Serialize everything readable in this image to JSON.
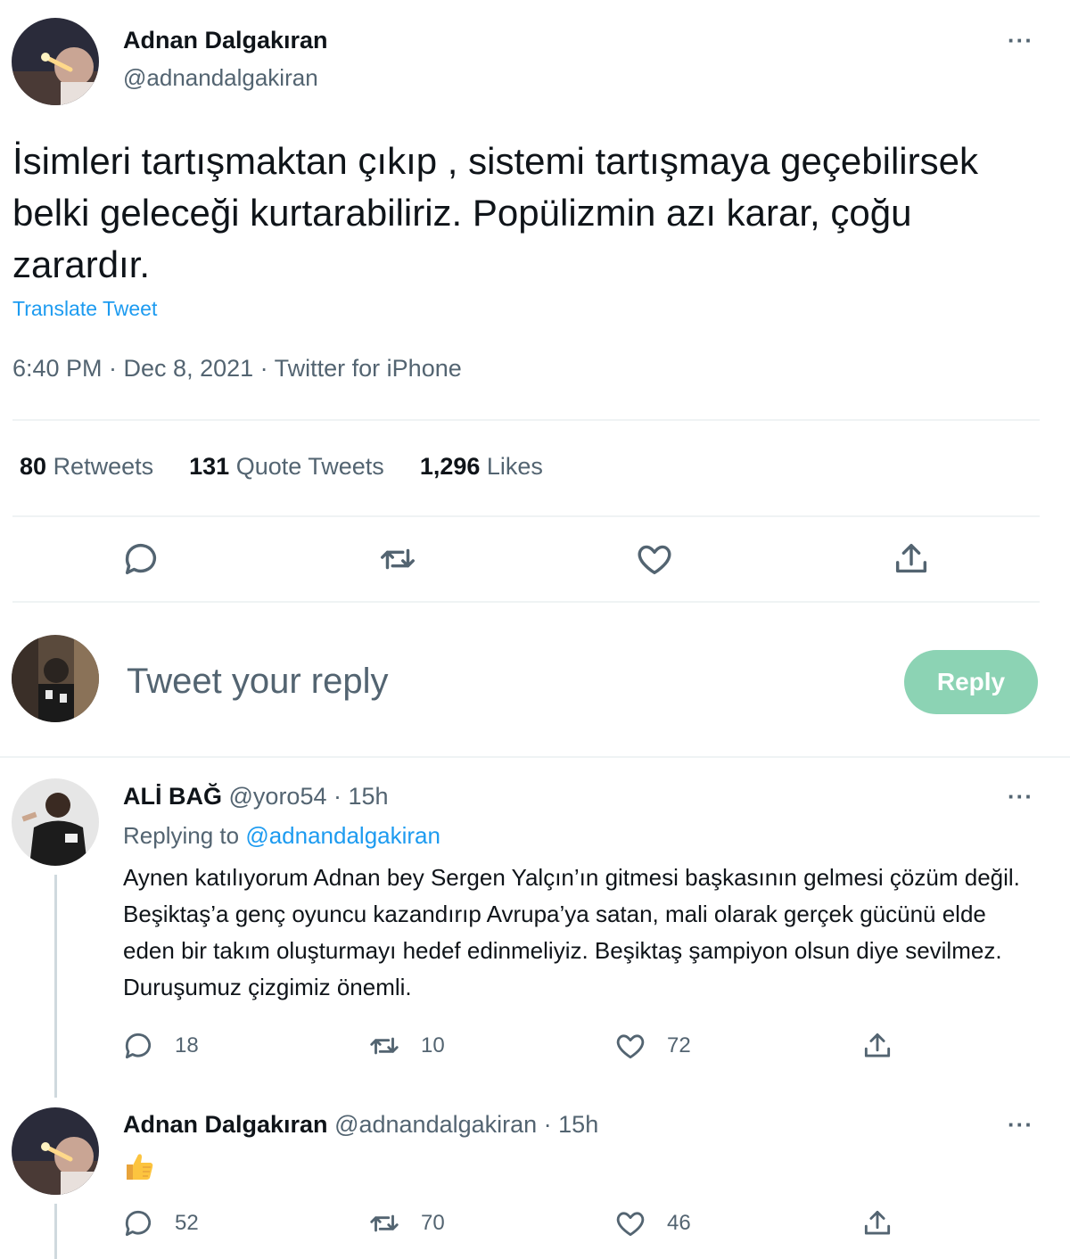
{
  "main_tweet": {
    "author_name": "Adnan Dalgakıran",
    "author_handle": "@adnandalgakiran",
    "more_label": "···",
    "text": "İsimleri tartışmaktan çıkıp , sistemi tartışmaya geçebilirsek belki geleceği kurtarabiliriz. Popülizmin azı karar, çoğu zarardır.",
    "translate_label": "Translate Tweet",
    "meta": "6:40 PM · Dec 8, 2021 · Twitter for iPhone",
    "stats": [
      {
        "count": "80",
        "label": "Retweets"
      },
      {
        "count": "131",
        "label": "Quote Tweets"
      },
      {
        "count": "1,296",
        "label": "Likes"
      }
    ]
  },
  "composer": {
    "placeholder": "Tweet your reply",
    "reply_button": "Reply"
  },
  "replies": [
    {
      "author_name": "ALİ BAĞ",
      "author_handle": "@yoro54",
      "time": "· 15h",
      "replying_prefix": "Replying to",
      "replying_to": "@adnandalgakiran",
      "text": "Aynen katılıyorum Adnan bey Sergen Yalçın’ın gitmesi başkasının gelmesi çözüm değil. Beşiktaş’a genç oyuncu kazandırıp Avrupa’ya satan, mali olarak gerçek gücünü elde eden bir takım oluşturmayı hedef edinmeliyiz. Beşiktaş şampiyon olsun diye sevilmez. Duruşumuz çizgimiz önemli.",
      "reply_count": "18",
      "retweet_count": "10",
      "like_count": "72",
      "more_label": "···"
    },
    {
      "author_name": "Adnan Dalgakıran",
      "author_handle": "@adnandalgakiran",
      "time": "· 15h",
      "emoji": "thumbs-up-icon",
      "reply_count": "52",
      "retweet_count": "70",
      "like_count": "46",
      "more_label": "···"
    }
  ],
  "colors": {
    "accent": "#1d9bf0",
    "reply_button_bg": "#8cd3b4",
    "secondary_text": "#536471",
    "divider": "#eff3f4"
  }
}
